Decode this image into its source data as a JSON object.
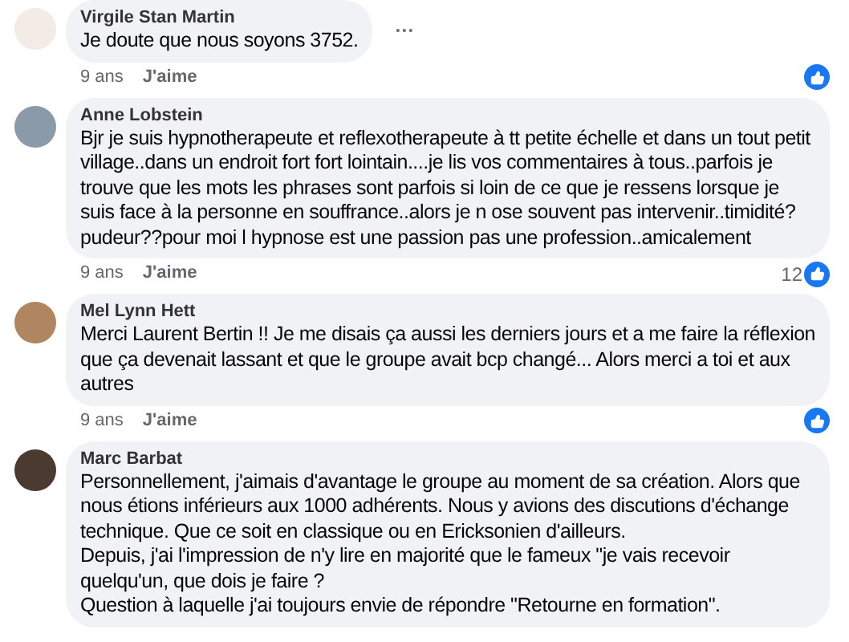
{
  "comments": [
    {
      "author": "Virgile Stan Martin",
      "paragraphs": [
        "Je doute que nous soyons 3752."
      ],
      "more_button": "···",
      "time": "9 ans",
      "like_label": "J'aime"
    },
    {
      "author": "Anne Lobstein",
      "paragraphs": [
        "Bjr je suis hypnotherapeute et reflexotherapeute à tt petite échelle et dans un tout petit village..dans un endroit fort fort lointain....je lis vos commentaires à tous..parfois je trouve que les mots les phrases sont parfois si loin de ce que je ressens lorsque je suis face à la personne en souffrance..alors je n ose souvent pas intervenir..timidité? pudeur??pour moi l hypnose est une passion pas une profession..amicalement"
      ],
      "time": "9 ans",
      "like_label": "J'aime",
      "reaction_count": "12"
    },
    {
      "author": "Mel Lynn Hett",
      "paragraphs": [
        "Merci Laurent Bertin !! Je me disais ça aussi les derniers jours et a me faire la réflexion que ça devenait lassant et que le groupe avait bcp changé... Alors merci a toi et aux autres"
      ],
      "time": "9 ans",
      "like_label": "J'aime"
    },
    {
      "author": "Marc Barbat",
      "paragraphs": [
        "Personnellement, j'aimais d'avantage le groupe au moment de sa création. Alors que nous étions inférieurs aux 1000 adhérents. Nous y avions des discutions d'échange technique. Que ce soit en classique ou en Ericksonien d'ailleurs.",
        "Depuis, j'ai l'impression de n'y lire en majorité que le fameux \"je vais recevoir quelqu'un, que dois je faire ?",
        "Question à laquelle j'ai toujours envie de répondre \"Retourne en formation\"."
      ]
    }
  ]
}
